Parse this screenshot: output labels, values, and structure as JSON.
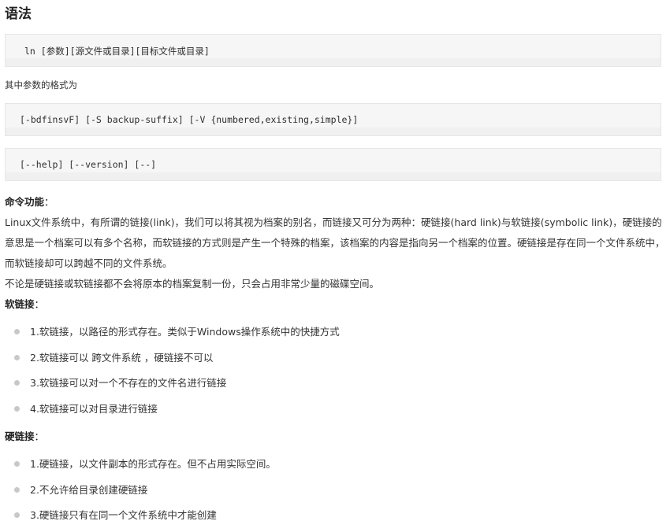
{
  "title": "语法",
  "code_block_1": {
    "cmd": "ln",
    "args": "[参数][源文件或目录][目标文件或目录]"
  },
  "format_intro": "其中参数的格式为",
  "code_block_2": {
    "line": "[-bdfinsvF] [-S backup-suffix] [-V {numbered,existing,simple}]"
  },
  "code_block_3": {
    "line": "[--help] [--version] [--]"
  },
  "function_section": {
    "heading": "命令功能",
    "colon": "：",
    "paragraph_1": "Linux文件系统中，有所谓的链接(link)，我们可以将其视为档案的别名，而链接又可分为两种：硬链接(hard link)与软链接(symbolic link)，硬链接的意思是一个档案可以有多个名称，而软链接的方式则是产生一个特殊的档案，该档案的内容是指向另一个档案的位置。硬链接是存在同一个文件系统中，而软链接却可以跨越不同的文件系统。",
    "paragraph_2": "不论是硬链接或软链接都不会将原本的档案复制一份，只会占用非常少量的磁碟空间。"
  },
  "soft_link": {
    "heading": "软链接",
    "colon": "：",
    "items": [
      "1.软链接，以路径的形式存在。类似于Windows操作系统中的快捷方式",
      "2.软链接可以 跨文件系统 ，硬链接不可以",
      "3.软链接可以对一个不存在的文件名进行链接",
      "4.软链接可以对目录进行链接"
    ]
  },
  "hard_link": {
    "heading": "硬链接",
    "colon": "：",
    "items": [
      "1.硬链接，以文件副本的形式存在。但不占用实际空间。",
      "2.不允许给目录创建硬链接",
      "3.硬链接只有在同一个文件系统中才能创建"
    ]
  }
}
